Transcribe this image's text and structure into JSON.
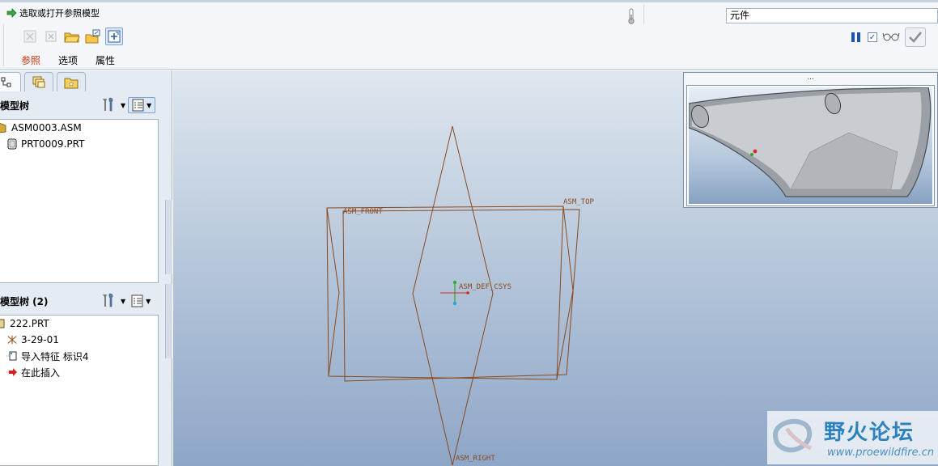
{
  "dashboard": {
    "prompt": "选取或打开参照模型",
    "tabs": [
      "参照",
      "选项",
      "属性"
    ],
    "component_field": "元件"
  },
  "navigator": {
    "top_panel": {
      "title": "模型树",
      "items": [
        {
          "label": "ASM0003.ASM",
          "icon": "assembly-icon"
        },
        {
          "label": "PRT0009.PRT",
          "icon": "part-icon"
        }
      ]
    },
    "bottom_panel": {
      "title": "模型树 (2)",
      "items": [
        {
          "label": "222.PRT",
          "icon": "part-icon"
        },
        {
          "label": "3-29-01",
          "icon": "coordinate-system-icon"
        },
        {
          "label": "导入特征 标识4",
          "icon": "import-feature-icon"
        },
        {
          "label": "在此插入",
          "icon": "insert-here-arrow-icon"
        }
      ]
    }
  },
  "graphics": {
    "datums": {
      "front": "ASM_FRONT",
      "top": "ASM_TOP",
      "right": "ASM_RIGHT",
      "csys": "ASM_DEF_CSYS"
    },
    "inset_title": "..."
  },
  "watermark": {
    "title": "野火论坛",
    "url": "www.proewildfire.cn"
  },
  "colors": {
    "datum": "#8a4a1e",
    "accent_tab": "#c33a12",
    "watermark": "#2b82bd"
  }
}
